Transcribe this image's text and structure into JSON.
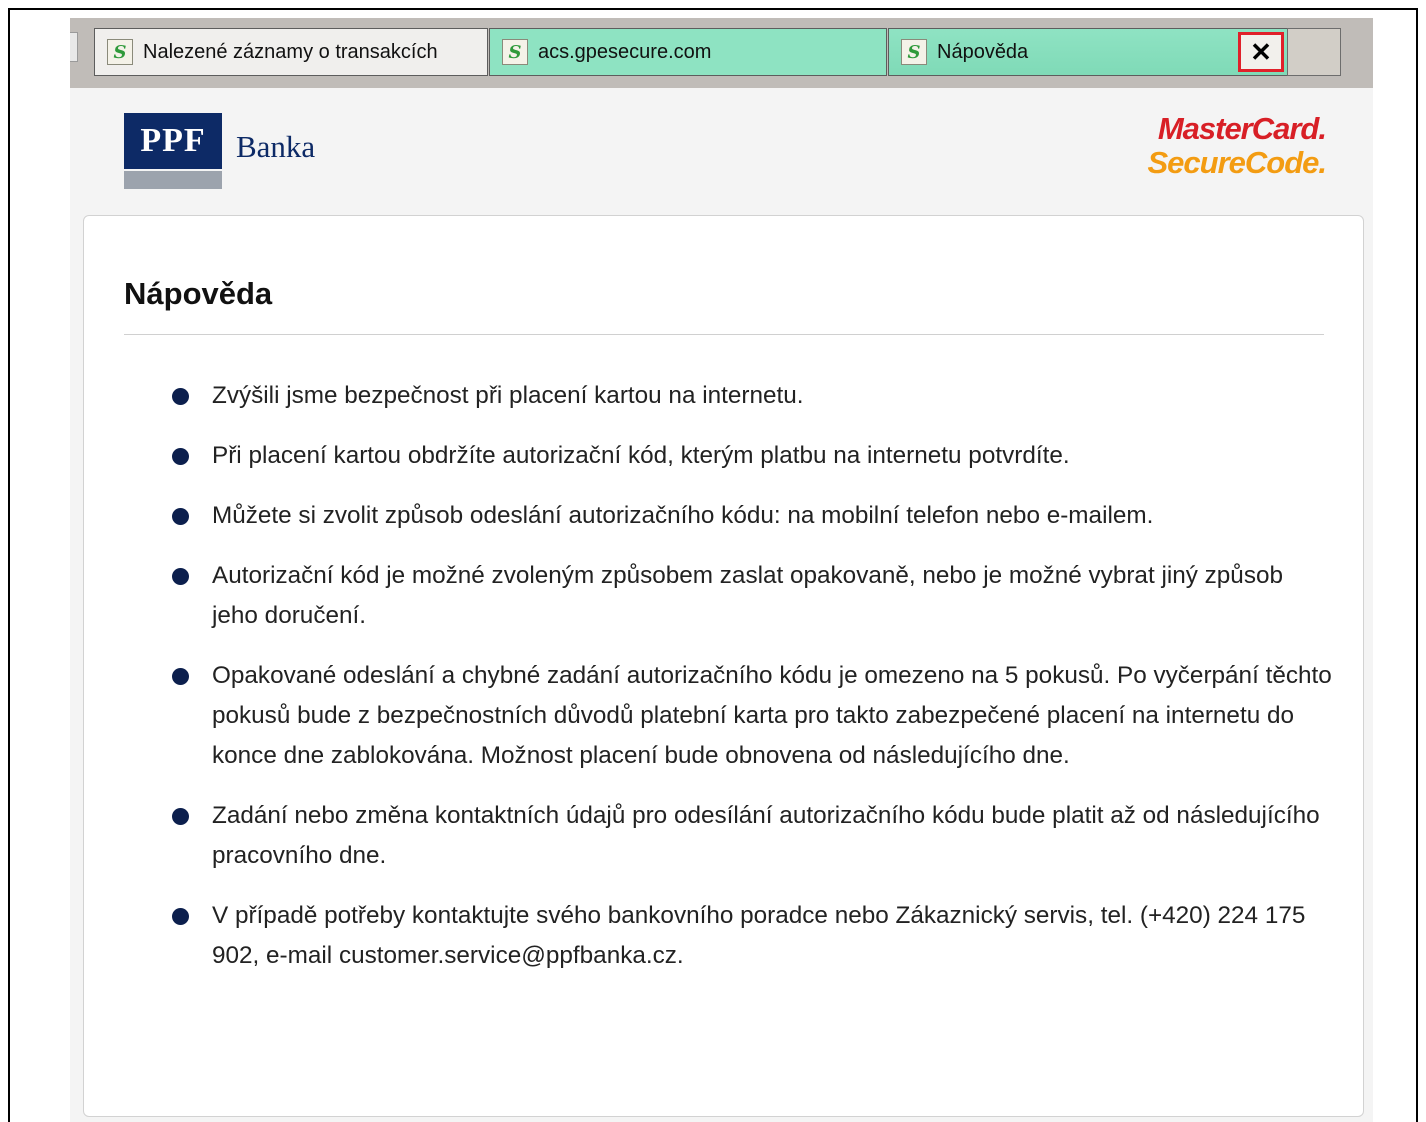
{
  "tabs": [
    {
      "label": "Nalezené záznamy o transakcích",
      "icon": "s-app-icon"
    },
    {
      "label": "acs.gpesecure.com",
      "icon": "s-app-icon"
    },
    {
      "label": "Nápověda",
      "icon": "s-app-icon"
    }
  ],
  "tab_icon_glyph": "S",
  "tab_close_glyph": "✕",
  "logos": {
    "ppf_box": "PPF",
    "ppf_name": "Banka",
    "mastercard_line1": "MasterCard.",
    "mastercard_line2": "SecureCode."
  },
  "colors": {
    "tab_active": "#8ee3c2",
    "ppf_blue": "#0d2a66",
    "mastercard_red": "#d81f26",
    "mastercard_orange": "#f39c12",
    "close_highlight": "#e0202a"
  },
  "help": {
    "title": "Nápověda",
    "items": [
      "Zvýšili jsme bezpečnost při placení kartou na internetu.",
      "Při placení kartou obdržíte autorizační kód, kterým platbu na internetu potvrdíte.",
      "Můžete si zvolit způsob odeslání autorizačního kódu: na mobilní telefon nebo e-mailem.",
      "Autorizační kód je možné zvoleným způsobem zaslat opakovaně, nebo je možné vybrat jiný způsob jeho doručení.",
      "Opakované odeslání a chybné zadání autorizačního kódu je omezeno na 5 pokusů. Po vyčerpání těchto pokusů bude z bezpečnostních důvodů platební karta pro takto zabezpečené placení na internetu do konce dne zablokována. Možnost placení bude obnovena od následujícího dne.",
      "Zadání nebo změna kontaktních údajů pro odesílání autorizačního kódu bude platit až od následujícího pracovního dne.",
      "V případě potřeby kontaktujte svého bankovního poradce nebo Zákaznický servis, tel. (+420) 224 175 902, e-mail customer.service@ppfbanka.cz."
    ]
  }
}
